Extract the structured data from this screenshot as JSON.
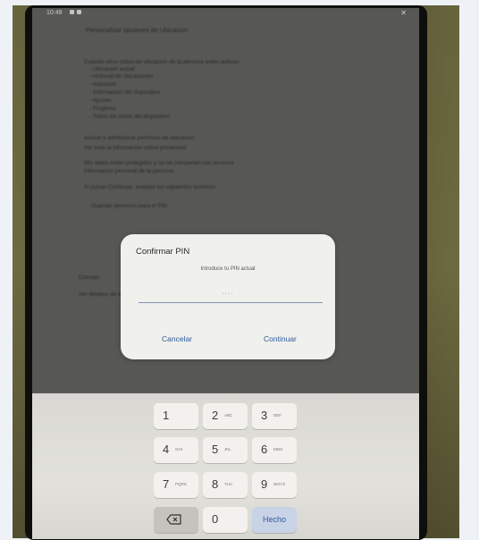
{
  "status_bar": {
    "time": "10:48"
  },
  "background": {
    "lines": [
      "Personalizar opciones de Ubicacion",
      "Cuando otros datos de ubicacion de la persona esten activos:",
      "- Ubicacion actual",
      "- Historial de ubicaciones",
      "- Actividad",
      "- Informacion del dispositivo",
      "- Ajustes",
      "- Progreso",
      "- Todos los datos del dispositivo",
      "Activar y administrar permisos de ubicacion",
      "Ver toda la informacion sobre privacidad",
      "Mis datos estan protegidos y no se comparten con terceros",
      "informacion personal de la persona",
      "Al pulsar Continuar, aceptas los siguientes terminos:",
      "Guardar permisos para el PIN",
      "Consejo",
      "Ver detalles de la configuracion y privacidad"
    ]
  },
  "dialog": {
    "title": "Confirmar PIN",
    "subtitle": "Introduce tu PIN actual",
    "pin_value": "····",
    "cancel_label": "Cancelar",
    "continue_label": "Continuar"
  },
  "keypad": {
    "keys": [
      {
        "digit": "1",
        "letters": ""
      },
      {
        "digit": "2",
        "letters": "ABC"
      },
      {
        "digit": "3",
        "letters": "DEF"
      },
      {
        "digit": "4",
        "letters": "GHI"
      },
      {
        "digit": "5",
        "letters": "JKL"
      },
      {
        "digit": "6",
        "letters": "MNO"
      },
      {
        "digit": "7",
        "letters": "PQRS"
      },
      {
        "digit": "8",
        "letters": "TUV"
      },
      {
        "digit": "9",
        "letters": "WXYZ"
      }
    ],
    "zero": "0",
    "done_label": "Hecho",
    "backspace_icon": "backspace-icon"
  },
  "colors": {
    "accent": "#2e5a9e",
    "screen_bg": "#5d5e5b",
    "dialog_bg": "#f0f0ec",
    "keyboard_bg": "#dcdbd6"
  }
}
